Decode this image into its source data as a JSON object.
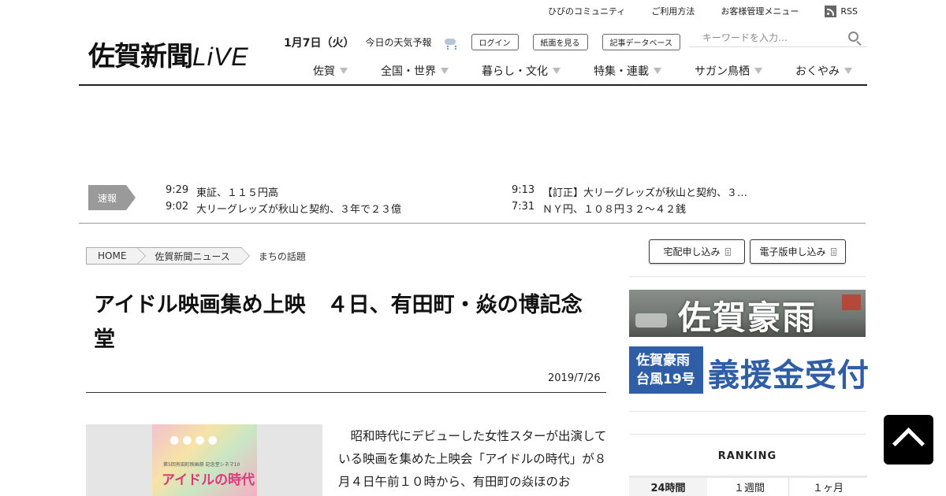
{
  "utility": {
    "links": [
      "ひびのコミュニティ",
      "ご利用方法",
      "お客様管理メニュー"
    ],
    "rss": "RSS"
  },
  "logo": {
    "main": "佐賀新聞",
    "suffix": "LiVE"
  },
  "header": {
    "date": "1月7日（火）",
    "weather": "今日の天気予報",
    "login": "ログイン",
    "paper": "紙面を見る",
    "database": "記事データベース"
  },
  "search": {
    "placeholder": "キーワードを入力…"
  },
  "nav": [
    "佐賀",
    "全国・世界",
    "暮らし・文化",
    "特集・連載",
    "サガン鳥栖",
    "おくやみ"
  ],
  "breaking": {
    "label": "速報",
    "items": [
      {
        "time": "9:29",
        "text": "東証、１１５円高"
      },
      {
        "time": "9:02",
        "text": "大リーグレッズが秋山と契約、３年で２３億"
      },
      {
        "time": "9:13",
        "text": "【訂正】大リーグレッズが秋山と契約、３…"
      },
      {
        "time": "7:31",
        "text": "ＮＹ円、１０８円３２～４２銭"
      }
    ]
  },
  "breadcrumb": {
    "home": "HOME",
    "section": "佐賀新聞ニュース",
    "current": "まちの話題"
  },
  "article": {
    "headline": "アイドル映画集め上映　４日、有田町・焱の博記念堂",
    "date": "2019/7/26",
    "body": "昭和時代にデビューした女性スターが出演している映画を集めた上映会「アイドルの時代」が８月４日午前１０時から、有田町の焱ほのお",
    "photo_title": "アイドルの時代",
    "photo_sub": "第5回有田町映画祭 記念堂シネマ10",
    "photo_dots": "●●●●"
  },
  "sidebar": {
    "delivery_button": "宅配申し込み",
    "digital_button": "電子版申し込み",
    "banner1_text": "佐賀豪雨",
    "banner2_box_line1": "佐賀豪雨",
    "banner2_box_line2": "台風19号",
    "banner2_text": "義援金受付",
    "ranking_title": "RANKING",
    "ranking_tabs": [
      "24時間",
      "１週間",
      "１ヶ月"
    ]
  }
}
